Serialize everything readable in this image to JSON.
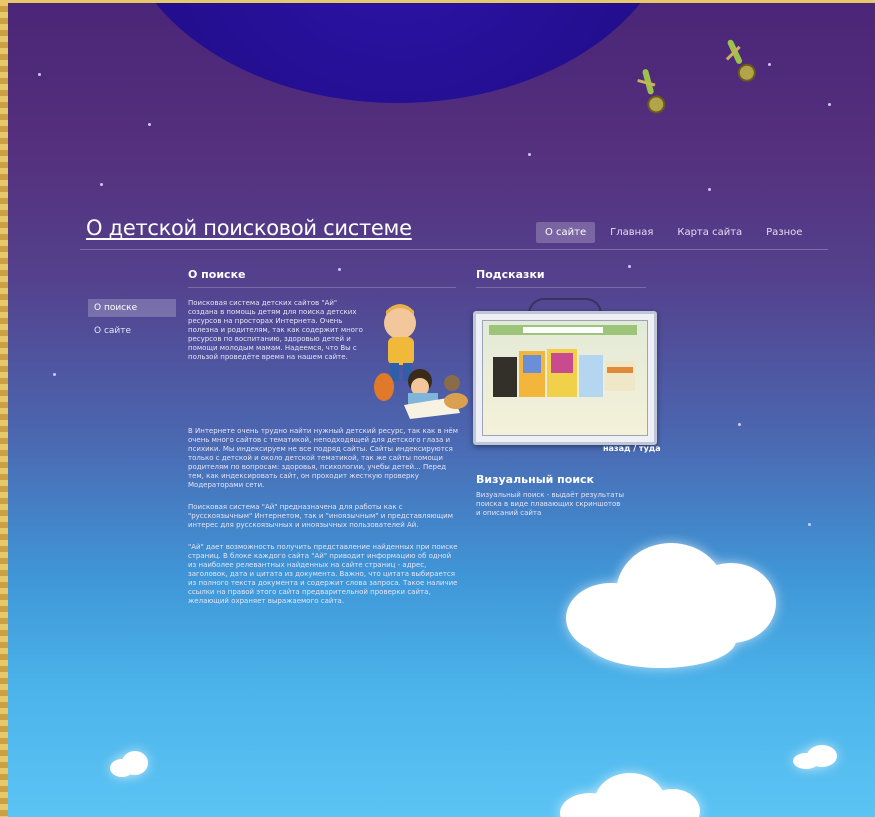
{
  "site": {
    "title": "О детской поисковой системе"
  },
  "topnav": {
    "items": [
      {
        "label": "О сайте",
        "active": true
      },
      {
        "label": "Главная",
        "active": false
      },
      {
        "label": "Карта сайта",
        "active": false
      },
      {
        "label": "Разное",
        "active": false
      }
    ]
  },
  "sidebar": {
    "items": [
      {
        "label": "О поиске",
        "active": true
      },
      {
        "label": "О сайте",
        "active": false
      }
    ]
  },
  "main": {
    "heading": "О поиске",
    "paragraphs": [
      "Поисковая система детских сайтов \"Ай\" создана в помощь детям для поиска детских ресурсов на просторах Интернета. Очень полезна и родителям, так как содержит много ресурсов по воспитанию, здоровью детей и помощи молодым мамам. Надеемся, что Вы с пользой проведёте время на нашем сайте.",
      "В Интернете очень трудно найти нужный детский ресурс, так как в нём очень много сайтов с тематикой, неподходящей для детского глаза и психики. Мы индексируем не все подряд сайты. Сайты индексируются только с детской и около детской тематикой, так же сайты помощи родителям по вопросам: здоровья, психологии, учебы детей... Перед тем, как индексировать сайт, он проходит жесткую проверку Модераторами сети.",
      "Поисковая система \"Ай\" предназначена для работы как с \"русскоязычным\" Интернетом, так и \"иноязычным\" и представляющим интерес для русскоязычных и иноязычных пользователей Ай.",
      "\"Ай\" дает возможность получить представление найденных при поиске страниц. В блоке каждого сайта \"Ай\" приводит информацию об одной из наиболее релевантных найденных на сайте страниц - адрес, заголовок, дата и цитата из документа. Важно, что цитата выбирается из полного текста документа и содержит слова запроса. Такое наличие ссылки на правой этого сайта предварительной проверки сайта, желающий охраняет выражаемого сайта."
    ]
  },
  "side": {
    "heading": "Подсказки",
    "caption": "назад / туда",
    "visual_heading": "Визуальный поиск",
    "visual_text": "Визуальный поиск - выдаёт результаты поиска в виде плавающих скриншотов и описаний сайта"
  },
  "colors": {
    "sky_top": "#4b2577",
    "sky_bottom": "#5cc4f4",
    "planet": "#230e8f",
    "frame": "#d9b24a"
  },
  "icons": [
    "hanging-figure-icon",
    "children-illustration",
    "screenshot-preview",
    "cloud-shape",
    "planet-shape"
  ]
}
